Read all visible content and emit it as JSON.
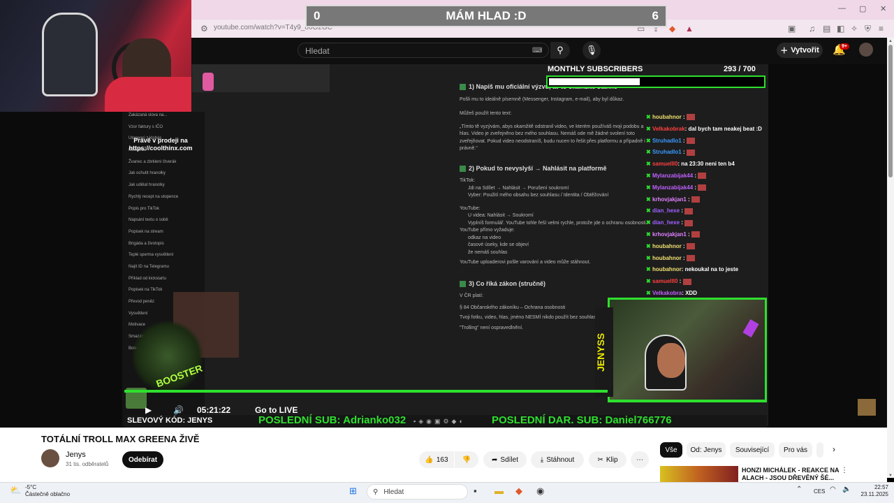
{
  "browser": {
    "url": "youtube.com/watch?v=T4y9_o6O2GC"
  },
  "overlay": {
    "score_left": "0",
    "score_title": "MÁM HLAD :D",
    "score_right": "6",
    "promo": "Právě v prodeji na https://coolthinx.com",
    "monthly_label": "MONTHLY SUBSCRIBERS",
    "monthly_value": "293 / 700",
    "monthly_progress": 0.42,
    "streamer_name": "JENYSS",
    "time": "05:21:22",
    "go_live": "Go to LIVE",
    "discount": "SLEVOVÝ KÓD: JENYS",
    "ticker_last_sub": "POSLEDNÍ SUB: Adrianko032",
    "ticker_last_gift": "POSLEDNÍ DAR. SUB: Daniel766776",
    "booster_label": "BOOSTER"
  },
  "chat": [
    {
      "name": "houbahnor",
      "color": "#f0e070",
      "msg": ""
    },
    {
      "name": "Velkakobrak",
      "color": "#ff4040",
      "msg": ": dal bych tam neakej beat :D"
    },
    {
      "name": "Struhadlo1",
      "color": "#3a9aff",
      "msg": ""
    },
    {
      "name": "Struhadlo1",
      "color": "#3a9aff",
      "msg": ""
    },
    {
      "name": "samuelll0",
      "color": "#ff4040",
      "msg": ": na 23:30 neni ten b4"
    },
    {
      "name": "Mylanzabijak44",
      "color": "#c060ff",
      "msg": ""
    },
    {
      "name": "Mylanzabijak44",
      "color": "#c060ff",
      "msg": ""
    },
    {
      "name": "krhovjakjan1",
      "color": "#e080ff",
      "msg": ""
    },
    {
      "name": "dian_hexe",
      "color": "#a060ff",
      "msg": ""
    },
    {
      "name": "dian_hexe",
      "color": "#a060ff",
      "msg": ""
    },
    {
      "name": "krhovjakjan1",
      "color": "#e080ff",
      "msg": ""
    },
    {
      "name": "houbahnor",
      "color": "#f0e070",
      "msg": ""
    },
    {
      "name": "houbahnor",
      "color": "#f0e070",
      "msg": ""
    },
    {
      "name": "houbahnor",
      "color": "#f0e070",
      "msg": ": nekoukal na to jeste"
    },
    {
      "name": "samuelll0",
      "color": "#ff4040",
      "msg": ""
    },
    {
      "name": "Velkakobra",
      "color": "#c060ff",
      "msg": ": XDD"
    }
  ],
  "sidebar_items": [
    "Zakázaná slova na...",
    "Vzor faktury s IČO",
    "Utopenci z klobás",
    "New chat",
    "Žvanec a zbrklení čtverák",
    "Jak ochutit hranolky",
    "Jak udělat hranolky",
    "Rychlý recept na utopence",
    "Popis pro TikTok",
    "Napsání textu o sobě",
    "Popisek na stream",
    "Brigáda a životopis",
    "Teplé sperma vysvětlení",
    "Najít ID na Telegramu",
    "Příklad od kickstartu",
    "Popisek na TikTok",
    "Převod peněz",
    "Vysvětlení",
    "Motivace",
    "Smazání videa",
    "Bolest"
  ],
  "doc": {
    "h1": "1) Napiš mu oficiální výzvu, ať to okamžitě stáhne",
    "p1": "Pošli mu to ideálně písemně (Messenger, Instagram, e-mail), aby byl důkaz.",
    "p2": "Můžeš použít tento text:",
    "quote": "„Tímto tě vyzývám, abys okamžitě odstranil video, ve kterém používáš moji podobu a hlas. Video je zveřejněno bez mého souhlasu. Nemáš ode mě žádné svolení toto zveřejňovat. Pokud video neodstraníš, budu nucen to řešit přes platformu a případně i právně.“",
    "h2": "2) Pokud to nevyslyší → Nahlásit na platformě",
    "tiktok": "TikTok:",
    "tiktok1": "Jdi na Sdílet → Nahlásit → Porušení soukromí",
    "tiktok2": "Vyber: Použití mého obsahu bez souhlasu / Identita / Obtěžování",
    "youtube": "YouTube:",
    "yt1": "U videa: Nahlásit → Soukromí",
    "yt2": "Vyplníš formulář. YouTube tohle řeší velmi rychle, protože jde o ochranu osobnosti.",
    "yt3": "YouTube přímo vyžaduje:",
    "b1": "odkaz na video",
    "b2": "časové úseky, kde se objeví",
    "b3": "že nemáš souhlas",
    "p3": "YouTube uploaderovi pošle varování a video může stáhnout.",
    "h3": "3) Co říká zákon (stručně)",
    "p4": "V ČR platí:",
    "p5": "§ 84 Občanského zákoníku – Ochrana osobnosti",
    "p6": "Tvoji fotku, video, hlas, jméno NESMÍ nikdo použít bez souhlasu.",
    "p7": "\"Trolling\" není ospravedlnění."
  },
  "youtube": {
    "search_placeholder": "Hledat",
    "create_label": "Vytvořit",
    "notif_badge": "9+",
    "title": "TOTÁLNÍ TROLL MAX GREENA ŽIVĚ",
    "channel": "Jenys",
    "subscribers": "31 tis. odběratelů",
    "subscribe": "Odebírat",
    "likes": "163",
    "share": "Sdílet",
    "download": "Stáhnout",
    "clip": "Klip",
    "chips": [
      "Vše",
      "Od: Jenys",
      "Související",
      "Pro vás"
    ],
    "rec_title": "HONZI MICHÁLEK - REAKCE NA ALACH - JSOU DŘEVĚNÝ ŠÉ..."
  },
  "taskbar": {
    "weather_temp": "-5°C",
    "weather_desc": "Částečně oblačno",
    "search": "Hledat",
    "lang": "CES",
    "time": "22:57",
    "date": "23.11.2025"
  }
}
